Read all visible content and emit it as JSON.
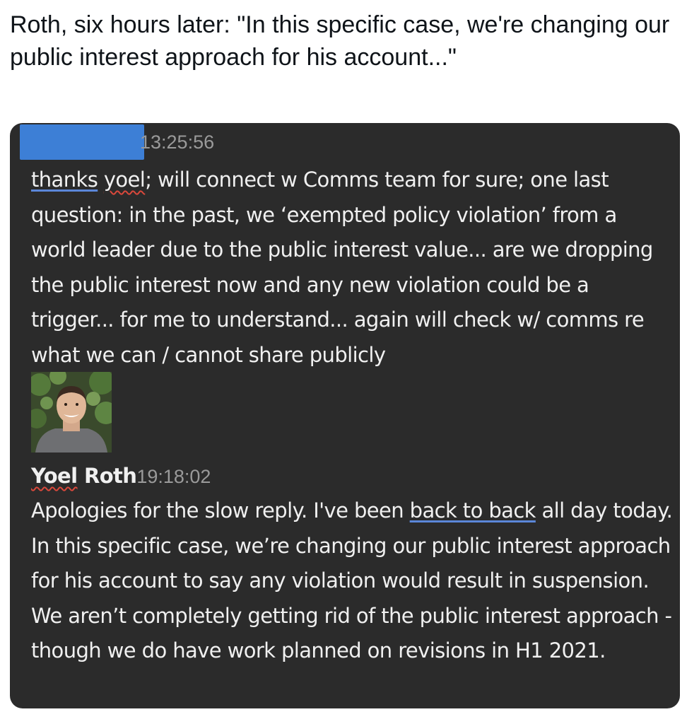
{
  "tweet": {
    "text": "Roth, six hours later: \"In this specific case, we're changing our public interest approach for his account...\""
  },
  "screenshot": {
    "message1": {
      "timestamp": "13:25:56",
      "text_part1": "thanks",
      "text_part2": "yoel",
      "text_part3": "; will connect w Comms team for sure; one last question: in the past, we ‘exempted policy violation’ from a world leader due to the public interest value... are we dropping the public interest now and any new violation could be a trigger... for me to understand... again will check w/ comms re what we can / cannot share publicly"
    },
    "message2": {
      "author": "Yoel",
      "author_last": " Roth",
      "timestamp": "19:18:02",
      "text_part1": "Apologies for the slow reply. I've been ",
      "text_part2": "back to back",
      "text_part3": " all day today. In this specific case, we’re changing our public interest approach for his account to say any violation would result in suspension. We aren’t completely getting rid of the public interest approach - though we do have work planned on revisions in H1 2021."
    },
    "avatar_icon": "person-photo",
    "colors": {
      "background": "#2b2b2b",
      "text": "#f0f0f0",
      "timestamp": "#9a9a9a",
      "redaction": "#3d7fd6"
    }
  }
}
